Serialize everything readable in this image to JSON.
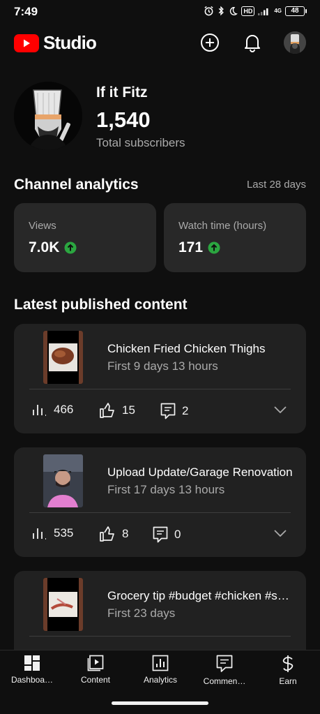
{
  "status_bar": {
    "time": "7:49",
    "hd": "HD",
    "network": "4G",
    "battery": "48"
  },
  "header": {
    "brand": "Studio",
    "icons": [
      "create-icon",
      "bell-icon",
      "avatar"
    ]
  },
  "channel": {
    "name": "If it Fitz",
    "subscribers": "1,540",
    "subscribers_label": "Total subscribers"
  },
  "analytics": {
    "title": "Channel analytics",
    "period": "Last 28 days",
    "cards": [
      {
        "label": "Views",
        "value": "7.0K",
        "trend": "up"
      },
      {
        "label": "Watch time (hours)",
        "value": "171",
        "trend": "up"
      }
    ]
  },
  "latest": {
    "title": "Latest published content",
    "items": [
      {
        "title": "Chicken Fried Chicken Thighs",
        "subtitle": "First 9 days 13 hours",
        "views": "466",
        "likes": "15",
        "comments": "2"
      },
      {
        "title": "Upload Update/Garage Renovation",
        "subtitle": "First 17 days 13 hours",
        "views": "535",
        "likes": "8",
        "comments": "0"
      },
      {
        "title": "Grocery tip #budget #chicken #shorts",
        "subtitle": "First 23 days",
        "views": "",
        "likes": "",
        "comments": ""
      }
    ]
  },
  "nav": [
    {
      "label": "Dashboa…",
      "icon": "dashboard-icon"
    },
    {
      "label": "Content",
      "icon": "content-icon"
    },
    {
      "label": "Analytics",
      "icon": "analytics-icon"
    },
    {
      "label": "Commen…",
      "icon": "comments-icon"
    },
    {
      "label": "Earn",
      "icon": "earn-icon"
    }
  ],
  "colors": {
    "accent_red": "#ff0000",
    "trend_green": "#2ba640",
    "background": "#0f0f0f",
    "card": "#212121"
  }
}
